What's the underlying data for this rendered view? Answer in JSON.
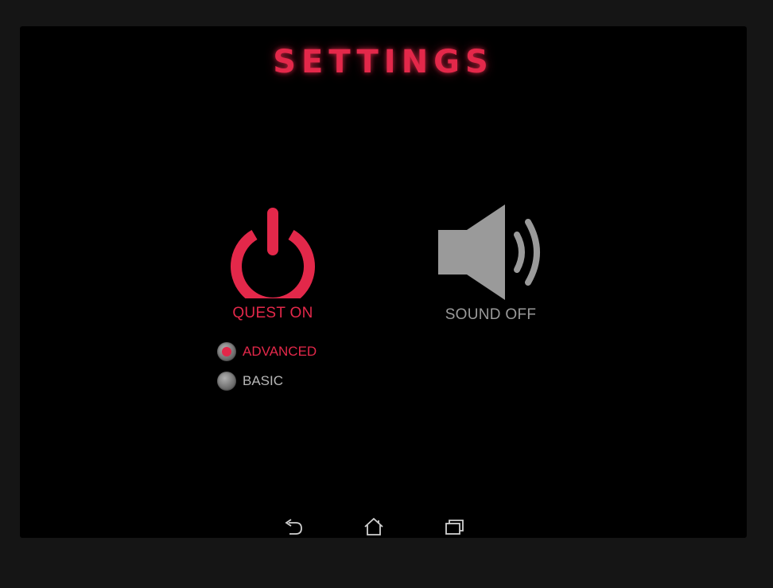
{
  "screen": {
    "title": "SETTINGS"
  },
  "quest": {
    "label": "QUEST ON",
    "icon": "power-icon",
    "state": "on"
  },
  "sound": {
    "label": "SOUND OFF",
    "icon": "speaker-icon",
    "state": "off"
  },
  "mode": {
    "options": [
      {
        "label": "ADVANCED",
        "selected": true
      },
      {
        "label": "BASIC",
        "selected": false
      }
    ]
  },
  "navbar": {
    "back_icon": "back-arrow-icon",
    "home_icon": "home-icon",
    "recent_icon": "recent-apps-icon"
  },
  "colors": {
    "accent": "#e3284a",
    "inactive": "#9a9a9a",
    "background": "#000000"
  }
}
